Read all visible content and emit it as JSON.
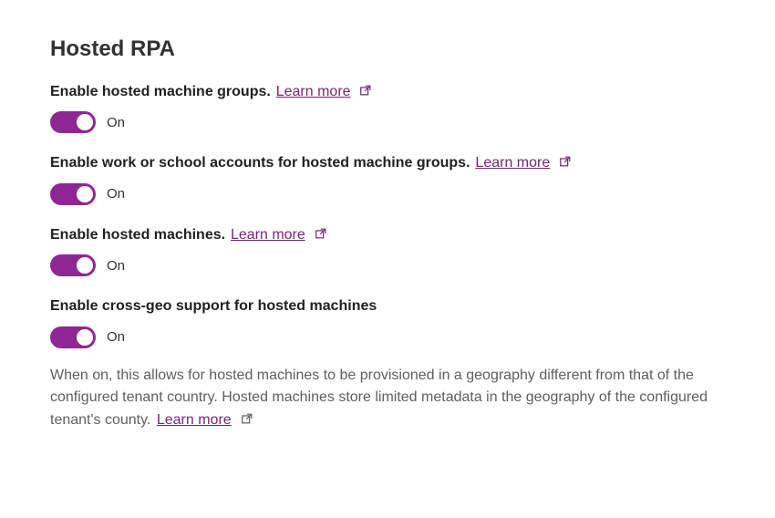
{
  "section": {
    "title": "Hosted RPA"
  },
  "settings": {
    "hostedMachineGroups": {
      "label": "Enable hosted machine groups.",
      "learnMore": "Learn more",
      "state": "On"
    },
    "workSchoolAccounts": {
      "label": "Enable work or school accounts for hosted machine groups.",
      "learnMore": "Learn more",
      "state": "On"
    },
    "hostedMachines": {
      "label": "Enable hosted machines.",
      "learnMore": "Learn more",
      "state": "On"
    },
    "crossGeo": {
      "label": "Enable cross-geo support for hosted machines",
      "state": "On",
      "description": "When on, this allows for hosted machines to be provisioned in a geography different from that of the configured tenant country. Hosted machines store limited metadata in the geography of the configured tenant's county.",
      "learnMore": "Learn more"
    }
  }
}
